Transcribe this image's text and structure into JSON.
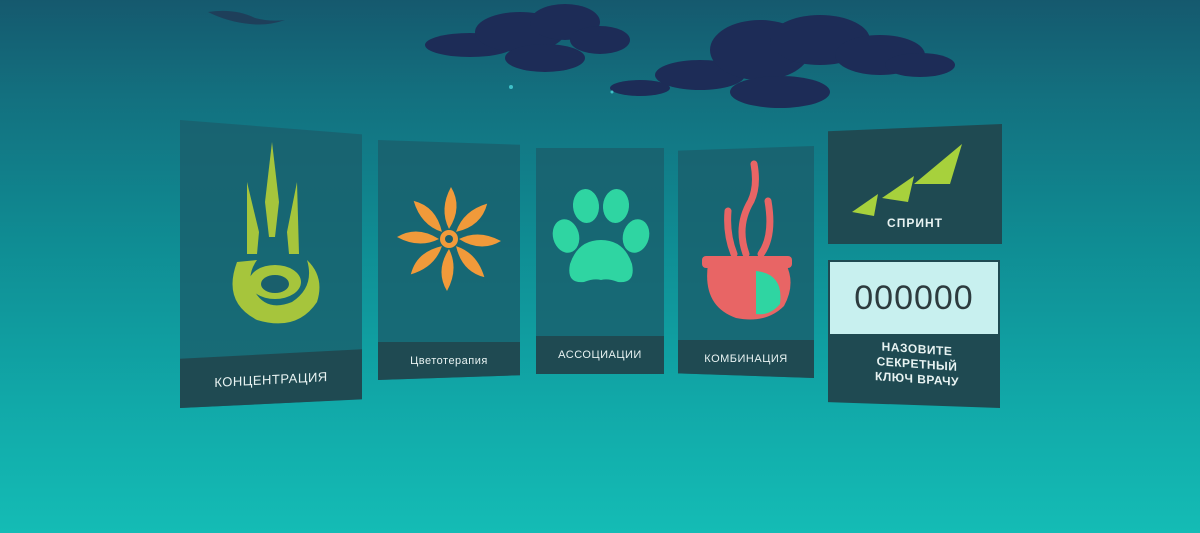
{
  "scene": {
    "background_colors": [
      "#15596e",
      "#0f8c93",
      "#14bcb5"
    ],
    "decorations": [
      "night-cloud",
      "star",
      "bird-silhouette"
    ]
  },
  "menu": {
    "tiles": [
      {
        "label": "КОНЦЕНТРАЦИЯ",
        "icon": "flame-swirl-icon",
        "color": "#a6c53c"
      },
      {
        "label": "Цветотерапия",
        "icon": "pinwheel-flower-icon",
        "color": "#f19a3a"
      },
      {
        "label": "АССОЦИАЦИИ",
        "icon": "paw-print-icon",
        "color": "#2fd5a2"
      },
      {
        "label": "КОМБИНАЦИЯ",
        "icon": "steaming-pot-icon",
        "color": "#e86565"
      }
    ],
    "sprint": {
      "label": "СПРИНТ",
      "icon": "triple-arrow-icon",
      "color": "#a7d13c"
    },
    "secret": {
      "code": "000000",
      "note_lines": [
        "НАЗОВИТЕ",
        "СЕКРЕТНЫЙ",
        "КЛЮЧ ВРАЧУ"
      ]
    }
  }
}
